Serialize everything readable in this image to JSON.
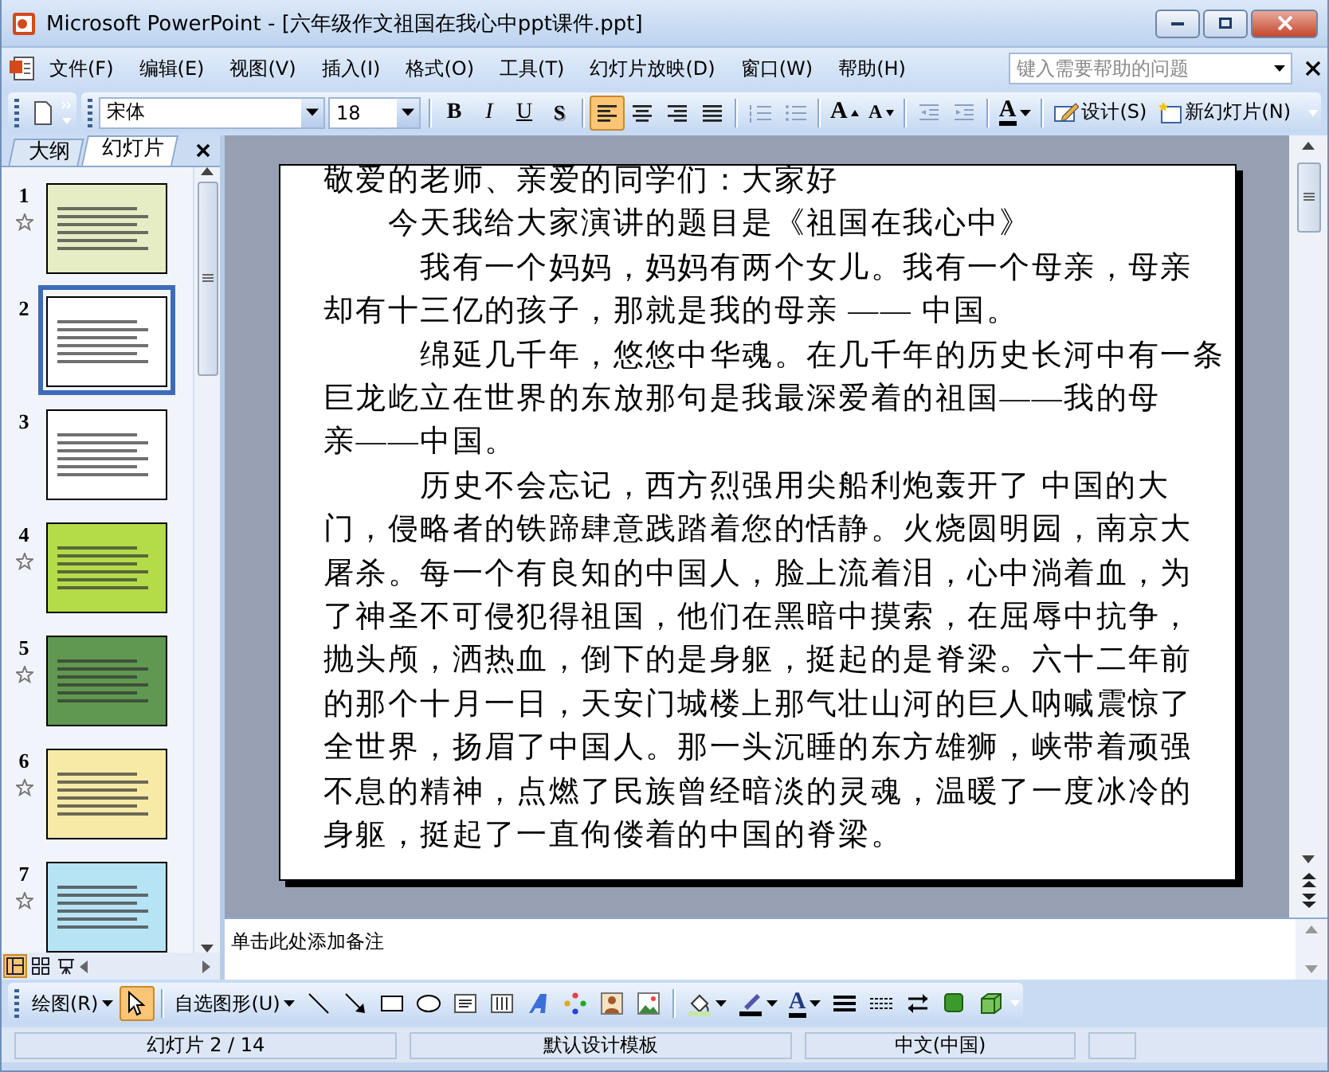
{
  "window": {
    "title": "Microsoft PowerPoint - [六年级作文祖国在我心中ppt课件.ppt]"
  },
  "menu": {
    "items": [
      "文件(F)",
      "编辑(E)",
      "视图(V)",
      "插入(I)",
      "格式(O)",
      "工具(T)",
      "幻灯片放映(D)",
      "窗口(W)",
      "帮助(H)"
    ],
    "help_search": {
      "placeholder": "键入需要帮助的问题"
    }
  },
  "formatting_toolbar": {
    "font": "宋体",
    "size": "18",
    "text_buttons": [
      {
        "kind": "bold",
        "label": "B"
      },
      {
        "kind": "italic",
        "label": "I"
      },
      {
        "kind": "underline",
        "label": "U"
      },
      {
        "kind": "shadow",
        "label": "S"
      }
    ],
    "alignment": [
      {
        "kind": "left",
        "selected": true
      },
      {
        "kind": "center",
        "selected": false
      },
      {
        "kind": "right",
        "selected": false
      },
      {
        "kind": "distributed",
        "selected": false
      }
    ],
    "size_buttons": [
      {
        "kind": "grow",
        "label": "A"
      },
      {
        "kind": "shrink",
        "label": "A"
      }
    ],
    "font_color": {
      "label": "A"
    },
    "buttons": [
      {
        "kind": "design",
        "label": "设计(S)"
      },
      {
        "kind": "new_slide",
        "label": "新幻灯片(N)"
      }
    ]
  },
  "side_pane": {
    "tabs": [
      {
        "label": "大纲",
        "selected": false
      },
      {
        "label": "幻灯片",
        "selected": true
      }
    ],
    "slides": [
      {
        "number": "1",
        "selected": false,
        "animated": true,
        "color": "#e6edc4"
      },
      {
        "number": "2",
        "selected": true,
        "animated": false,
        "color": "#ffffff"
      },
      {
        "number": "3",
        "selected": false,
        "animated": false,
        "color": "#ffffff"
      },
      {
        "number": "4",
        "selected": false,
        "animated": true,
        "color": "#b3dc48"
      },
      {
        "number": "5",
        "selected": false,
        "animated": true,
        "color": "#5f9850"
      },
      {
        "number": "6",
        "selected": false,
        "animated": true,
        "color": "#f6eaa6"
      },
      {
        "number": "7",
        "selected": false,
        "animated": true,
        "color": "#b7e4f4"
      }
    ]
  },
  "slide": {
    "lines": [
      "敬爱的老师、亲爱的同学们：大家好",
      "　　今天我给大家演讲的题目是《祖国在我心中》",
      "　　　我有一个妈妈，妈妈有两个女儿。我有一个母亲，母亲",
      "却有十三亿的孩子，那就是我的母亲 —— 中国。",
      "　　　绵延几千年，悠悠中华魂。在几千年的历史长河中有一条",
      "巨龙屹立在世界的东放那句是我最深爱着的祖国——我的母",
      "亲——中国。",
      "　　　历史不会忘记，西方烈强用尖船利炮轰开了 中国的大",
      "门，侵略者的铁蹄肆意践踏着您的恬静。火烧圆明园，南京大",
      "屠杀。每一个有良知的中国人，脸上流着泪，心中淌着血，为",
      "了神圣不可侵犯得祖国，他们在黑暗中摸索，在屈辱中抗争，",
      "抛头颅，洒热血，倒下的是身躯，挺起的是脊梁。六十二年前",
      "的那个十月一日，天安门城楼上那气壮山河的巨人呐喊震惊了",
      "全世界，扬眉了中国人。那一头沉睡的东方雄狮，峡带着顽强",
      "不息的精神，点燃了民族曾经暗淡的灵魂，温暖了一度冰冷的",
      "身躯，挺起了一直佝偻着的中国的脊梁。"
    ]
  },
  "notes": {
    "placeholder": "单击此处添加备注"
  },
  "drawing_toolbar": {
    "draw_menu": "绘图(R)",
    "select_tool": {
      "selected": true
    },
    "autoshapes": "自选图形(U)",
    "font_color": {
      "label": "A"
    }
  },
  "status_bar": [
    "幻灯片 2 / 14",
    "默认设计模板",
    "中文(中国)"
  ]
}
